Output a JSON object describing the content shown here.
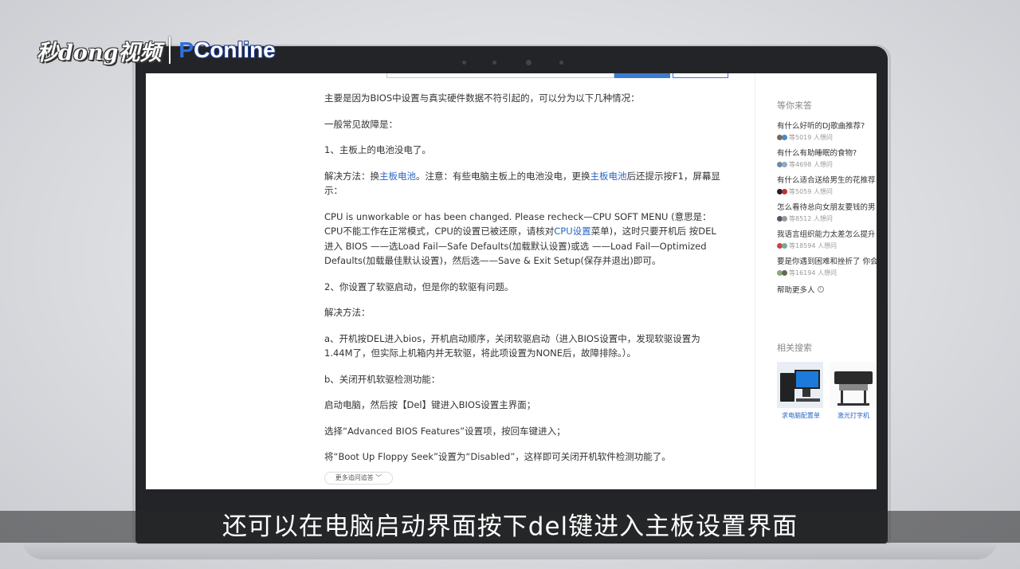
{
  "watermark": {
    "brand_cn": "秒dong视频",
    "brand_p": "P",
    "brand_rest": "Conline"
  },
  "article": {
    "paras": [
      "主要是因为BIOS中设置与真实硬件数据不符引起的，可以分为以下几种情况：",
      "一般常见故障是：",
      "1、主板上的电池没电了。"
    ],
    "solution1_a": "解决方法：换",
    "solution1_link1": "主板电池",
    "solution1_b": "。注意：有些电脑主板上的电池没电，更换",
    "solution1_link2": "主板电池",
    "solution1_c": "后还提示按F1，屏幕显示：",
    "cpu_a": "CPU is unworkable or has been changed. Please recheck—CPU SOFT MENU (意思是：CPU不能工作在正常模式，CPU的设置已被还原，请核对",
    "cpu_link": "CPU设置",
    "cpu_b": "菜单)，这时只要开机后 按DEL 进入 BIOS ——选Load Fail—Safe Defaults(加载默认设置)或选 ——Load Fail—Optimized Defaults(加载最佳默认设置)，然后选——Save & Exit Setup(保存并退出)即可。",
    "paras2": [
      "2、你设置了软驱启动，但是你的软驱有问题。",
      "解决方法：",
      "a、开机按DEL进入bios，开机启动顺序，关闭软驱启动（进入BIOS设置中，发现软驱设置为1.44M了，但实际上机箱内并无软驱，将此项设置为NONE后，故障排除。）。",
      "b、关闭开机软驱检测功能：",
      "启动电脑，然后按【Del】键进入BIOS设置主界面；",
      "选择“Advanced BIOS Features”设置项，按回车键进入；",
      "将“Boot Up Floppy Seek”设置为“Disabled”，这样即可关闭开机软件检测功能了。"
    ],
    "more_label": "更多追问追答 ﹀"
  },
  "sidebar": {
    "title": "等你来答",
    "questions": [
      {
        "text": "有什么好听的DJ歌曲推荐?",
        "meta": "等5019 人想问"
      },
      {
        "text": "有什么有助睡眠的食物?",
        "meta": "等4698 人想问"
      },
      {
        "text": "有什么适合送给男生的花推荐",
        "meta": "等5059 人想问"
      },
      {
        "text": "怎么看待总向女朋友要钱的男",
        "meta": "等8512 人想问"
      },
      {
        "text": "我语言组织能力太差怎么提升",
        "meta": "等18594 人想问"
      },
      {
        "text": "要是你遇到困难和挫折了 你会",
        "meta": "等16194 人想问"
      }
    ],
    "help_label": "帮助更多人",
    "related_title": "相关搜索",
    "related": [
      {
        "label": "求电脑配置单"
      },
      {
        "label": "激光打字机"
      }
    ]
  },
  "caption": "还可以在电脑启动界面按下del键进入主板设置界面",
  "colors": {
    "link": "#2a66c4",
    "accent": "#3a7bd5"
  }
}
